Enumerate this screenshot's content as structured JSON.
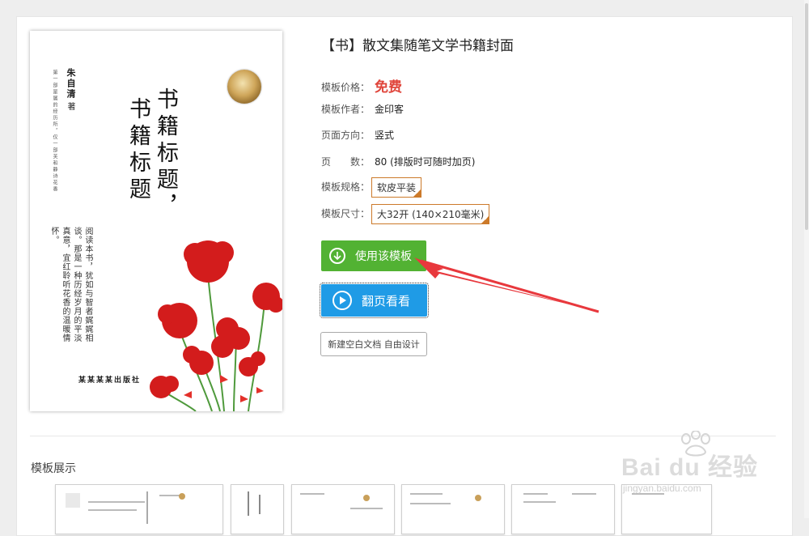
{
  "book": {
    "title": "【书】散文集随笔文学书籍封面",
    "fields": [
      {
        "label": "模板价格：",
        "value": "免费"
      },
      {
        "label": "模板作者：",
        "value": "金印客"
      },
      {
        "label": "页面方向：",
        "value": "竖式"
      },
      {
        "label": "页　　数：",
        "value": "80 (排版时可随时加页)"
      },
      {
        "label": "模板规格：",
        "value": "软皮平装"
      },
      {
        "label": "模板尺寸：",
        "value": "大32开 (140×210毫米)"
      }
    ]
  },
  "buttons": {
    "use_template": "使用该模板",
    "flip_view": "翻页看看",
    "blank_doc": "新建空白文档 自由设计"
  },
  "cover": {
    "author": "朱自清",
    "author_role": "著",
    "spine_note": "第一部是属的经历所，仅一部芙和静诗花香",
    "title_line1": "书籍标题，",
    "title_line2": "书籍标题",
    "quote": "阅读本书，犹如与智者娓娓相谈。那是一种历经岁月的平淡真意，宜红聆听花香的温暖情怀。",
    "publisher": "某某某某出版社"
  },
  "gallery": {
    "title": "模板展示"
  },
  "watermark": {
    "logo": "Bai du 经验",
    "url": "jingyan.baidu.com"
  },
  "colors": {
    "price": "#e0463c",
    "use_button": "#52b233",
    "flip_button": "#1f9be6",
    "spec_border": "#cc7a2a",
    "arrow": "#e8383d"
  }
}
